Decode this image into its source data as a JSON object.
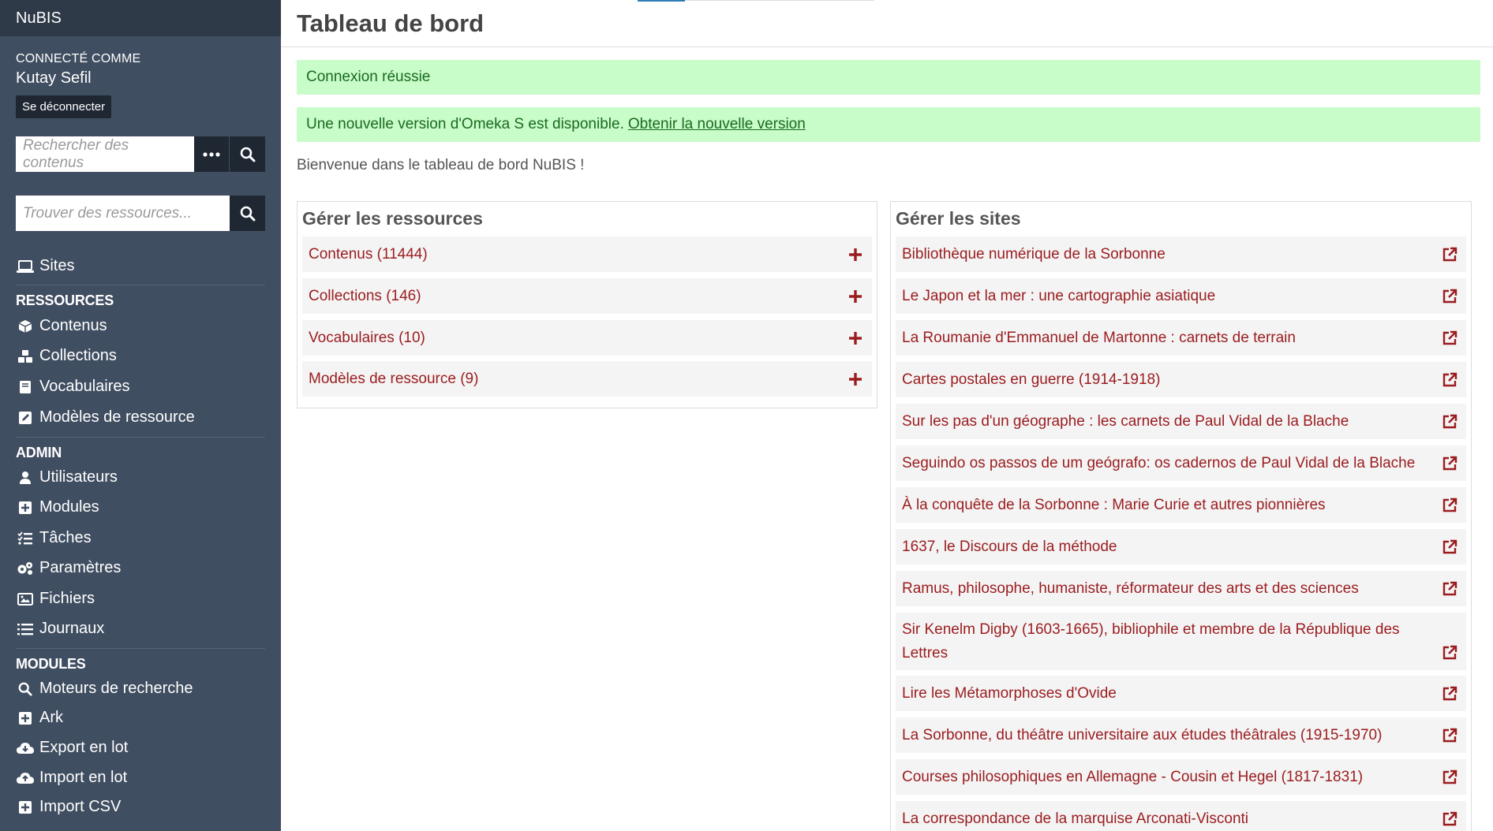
{
  "app": {
    "brand": "NuBIS"
  },
  "user": {
    "logged_in_label": "CONNECTÉ COMME",
    "name": "Kutay Sefil",
    "logout_label": "Se déconnecter"
  },
  "search": {
    "placeholder": "Rechercher des contenus",
    "resource_placeholder": "Trouver des ressources..."
  },
  "sidebar": {
    "sites": "Sites",
    "resources_heading": "RESSOURCES",
    "resources": [
      "Contenus",
      "Collections",
      "Vocabulaires",
      "Modèles de ressource"
    ],
    "admin_heading": "ADMIN",
    "admin": [
      "Utilisateurs",
      "Modules",
      "Tâches",
      "Paramètres",
      "Fichiers",
      "Journaux"
    ],
    "modules_heading": "MODULES",
    "modules": [
      "Moteurs de recherche",
      "Ark",
      "Export en lot",
      "Import en lot",
      "Import CSV"
    ]
  },
  "main": {
    "title": "Tableau de bord",
    "messages": {
      "login_success": "Connexion réussie",
      "update_text": "Une nouvelle version d'Omeka S est disponible.",
      "update_link": "Obtenir la nouvelle version"
    },
    "welcome": "Bienvenue dans le tableau de bord NuBIS !",
    "resources_panel": {
      "title": "Gérer les ressources",
      "items": [
        "Contenus (11444)",
        "Collections (146)",
        "Vocabulaires (10)",
        "Modèles de ressource (9)"
      ]
    },
    "sites_panel": {
      "title": "Gérer les sites",
      "items": [
        "Bibliothèque numérique de la Sorbonne",
        "Le Japon et la mer : une cartographie asiatique",
        "La Roumanie d'Emmanuel de Martonne : carnets de terrain",
        "Cartes postales en guerre (1914-1918)",
        "Sur les pas d'un géographe : les carnets de Paul Vidal de la Blache",
        "Seguindo os passos de um geógrafo: os cadernos de Paul Vidal de la Blache",
        "À la conquête de la Sorbonne : Marie Curie et autres pionnières",
        "1637, le Discours de la méthode",
        "Ramus, philosophe, humaniste, réformateur des arts et des sciences",
        "Sir Kenelm Digby (1603-1665), bibliophile et membre de la République des Lettres",
        "Lire les Métamorphoses d'Ovide",
        "La Sorbonne, du théâtre universitaire aux études théâtrales (1915-1970)",
        "Courses philosophiques en Allemagne - Cousin et Hegel (1817-1831)",
        "La correspondance de la marquise Arconati-Visconti"
      ]
    }
  },
  "colors": {
    "sidebar": "#404e61",
    "brand_bar": "#2f3a48",
    "link": "#9b1c1f",
    "success_bg": "#c8fcc9"
  }
}
